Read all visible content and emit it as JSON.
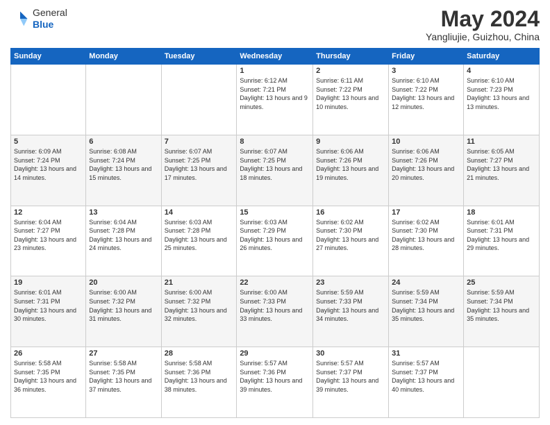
{
  "header": {
    "logo_line1": "General",
    "logo_line2": "Blue",
    "title": "May 2024",
    "subtitle": "Yangliujie, Guizhou, China"
  },
  "weekdays": [
    "Sunday",
    "Monday",
    "Tuesday",
    "Wednesday",
    "Thursday",
    "Friday",
    "Saturday"
  ],
  "weeks": [
    [
      {
        "day": "",
        "sunrise": "",
        "sunset": "",
        "daylight": ""
      },
      {
        "day": "",
        "sunrise": "",
        "sunset": "",
        "daylight": ""
      },
      {
        "day": "",
        "sunrise": "",
        "sunset": "",
        "daylight": ""
      },
      {
        "day": "1",
        "sunrise": "Sunrise: 6:12 AM",
        "sunset": "Sunset: 7:21 PM",
        "daylight": "Daylight: 13 hours and 9 minutes."
      },
      {
        "day": "2",
        "sunrise": "Sunrise: 6:11 AM",
        "sunset": "Sunset: 7:22 PM",
        "daylight": "Daylight: 13 hours and 10 minutes."
      },
      {
        "day": "3",
        "sunrise": "Sunrise: 6:10 AM",
        "sunset": "Sunset: 7:22 PM",
        "daylight": "Daylight: 13 hours and 12 minutes."
      },
      {
        "day": "4",
        "sunrise": "Sunrise: 6:10 AM",
        "sunset": "Sunset: 7:23 PM",
        "daylight": "Daylight: 13 hours and 13 minutes."
      }
    ],
    [
      {
        "day": "5",
        "sunrise": "Sunrise: 6:09 AM",
        "sunset": "Sunset: 7:24 PM",
        "daylight": "Daylight: 13 hours and 14 minutes."
      },
      {
        "day": "6",
        "sunrise": "Sunrise: 6:08 AM",
        "sunset": "Sunset: 7:24 PM",
        "daylight": "Daylight: 13 hours and 15 minutes."
      },
      {
        "day": "7",
        "sunrise": "Sunrise: 6:07 AM",
        "sunset": "Sunset: 7:25 PM",
        "daylight": "Daylight: 13 hours and 17 minutes."
      },
      {
        "day": "8",
        "sunrise": "Sunrise: 6:07 AM",
        "sunset": "Sunset: 7:25 PM",
        "daylight": "Daylight: 13 hours and 18 minutes."
      },
      {
        "day": "9",
        "sunrise": "Sunrise: 6:06 AM",
        "sunset": "Sunset: 7:26 PM",
        "daylight": "Daylight: 13 hours and 19 minutes."
      },
      {
        "day": "10",
        "sunrise": "Sunrise: 6:06 AM",
        "sunset": "Sunset: 7:26 PM",
        "daylight": "Daylight: 13 hours and 20 minutes."
      },
      {
        "day": "11",
        "sunrise": "Sunrise: 6:05 AM",
        "sunset": "Sunset: 7:27 PM",
        "daylight": "Daylight: 13 hours and 21 minutes."
      }
    ],
    [
      {
        "day": "12",
        "sunrise": "Sunrise: 6:04 AM",
        "sunset": "Sunset: 7:27 PM",
        "daylight": "Daylight: 13 hours and 23 minutes."
      },
      {
        "day": "13",
        "sunrise": "Sunrise: 6:04 AM",
        "sunset": "Sunset: 7:28 PM",
        "daylight": "Daylight: 13 hours and 24 minutes."
      },
      {
        "day": "14",
        "sunrise": "Sunrise: 6:03 AM",
        "sunset": "Sunset: 7:28 PM",
        "daylight": "Daylight: 13 hours and 25 minutes."
      },
      {
        "day": "15",
        "sunrise": "Sunrise: 6:03 AM",
        "sunset": "Sunset: 7:29 PM",
        "daylight": "Daylight: 13 hours and 26 minutes."
      },
      {
        "day": "16",
        "sunrise": "Sunrise: 6:02 AM",
        "sunset": "Sunset: 7:30 PM",
        "daylight": "Daylight: 13 hours and 27 minutes."
      },
      {
        "day": "17",
        "sunrise": "Sunrise: 6:02 AM",
        "sunset": "Sunset: 7:30 PM",
        "daylight": "Daylight: 13 hours and 28 minutes."
      },
      {
        "day": "18",
        "sunrise": "Sunrise: 6:01 AM",
        "sunset": "Sunset: 7:31 PM",
        "daylight": "Daylight: 13 hours and 29 minutes."
      }
    ],
    [
      {
        "day": "19",
        "sunrise": "Sunrise: 6:01 AM",
        "sunset": "Sunset: 7:31 PM",
        "daylight": "Daylight: 13 hours and 30 minutes."
      },
      {
        "day": "20",
        "sunrise": "Sunrise: 6:00 AM",
        "sunset": "Sunset: 7:32 PM",
        "daylight": "Daylight: 13 hours and 31 minutes."
      },
      {
        "day": "21",
        "sunrise": "Sunrise: 6:00 AM",
        "sunset": "Sunset: 7:32 PM",
        "daylight": "Daylight: 13 hours and 32 minutes."
      },
      {
        "day": "22",
        "sunrise": "Sunrise: 6:00 AM",
        "sunset": "Sunset: 7:33 PM",
        "daylight": "Daylight: 13 hours and 33 minutes."
      },
      {
        "day": "23",
        "sunrise": "Sunrise: 5:59 AM",
        "sunset": "Sunset: 7:33 PM",
        "daylight": "Daylight: 13 hours and 34 minutes."
      },
      {
        "day": "24",
        "sunrise": "Sunrise: 5:59 AM",
        "sunset": "Sunset: 7:34 PM",
        "daylight": "Daylight: 13 hours and 35 minutes."
      },
      {
        "day": "25",
        "sunrise": "Sunrise: 5:59 AM",
        "sunset": "Sunset: 7:34 PM",
        "daylight": "Daylight: 13 hours and 35 minutes."
      }
    ],
    [
      {
        "day": "26",
        "sunrise": "Sunrise: 5:58 AM",
        "sunset": "Sunset: 7:35 PM",
        "daylight": "Daylight: 13 hours and 36 minutes."
      },
      {
        "day": "27",
        "sunrise": "Sunrise: 5:58 AM",
        "sunset": "Sunset: 7:35 PM",
        "daylight": "Daylight: 13 hours and 37 minutes."
      },
      {
        "day": "28",
        "sunrise": "Sunrise: 5:58 AM",
        "sunset": "Sunset: 7:36 PM",
        "daylight": "Daylight: 13 hours and 38 minutes."
      },
      {
        "day": "29",
        "sunrise": "Sunrise: 5:57 AM",
        "sunset": "Sunset: 7:36 PM",
        "daylight": "Daylight: 13 hours and 39 minutes."
      },
      {
        "day": "30",
        "sunrise": "Sunrise: 5:57 AM",
        "sunset": "Sunset: 7:37 PM",
        "daylight": "Daylight: 13 hours and 39 minutes."
      },
      {
        "day": "31",
        "sunrise": "Sunrise: 5:57 AM",
        "sunset": "Sunset: 7:37 PM",
        "daylight": "Daylight: 13 hours and 40 minutes."
      },
      {
        "day": "",
        "sunrise": "",
        "sunset": "",
        "daylight": ""
      }
    ]
  ]
}
